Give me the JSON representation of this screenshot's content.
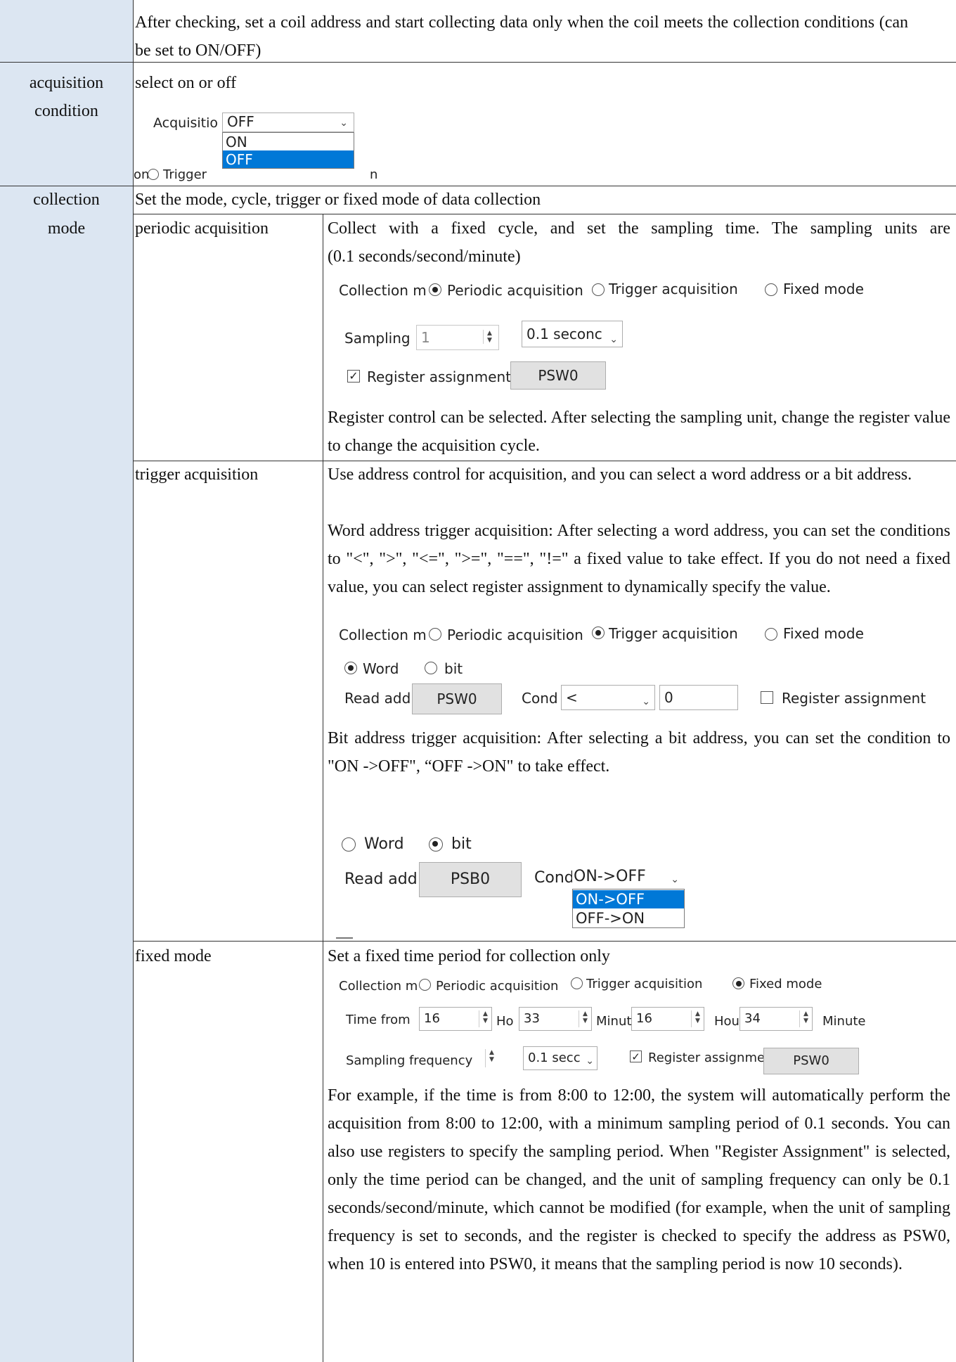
{
  "rows": {
    "coil": {
      "text": "After checking, set a coil address and start collecting data only when the coil meets the collection conditions (can be set to ON/OFF)"
    },
    "acquisition_condition": {
      "label_line1": "acquisition",
      "label_line2": "condition",
      "text": "select on or off",
      "ui": {
        "label": "Acquisitio",
        "selected": "OFF",
        "options": [
          "ON",
          "OFF"
        ],
        "under_left": "on",
        "under_radio_label": "Trigger",
        "under_right": "n"
      }
    },
    "collection_mode": {
      "label_line1": "collection",
      "label_line2": "mode",
      "text": "Set the mode, cycle, trigger or fixed mode of data collection"
    }
  },
  "periodic": {
    "name": "periodic acquisition",
    "desc_line1": "Collect with a fixed cycle, and set the sampling time. The sampling units are",
    "desc_line2": "(0.1 seconds/second/minute)",
    "ui": {
      "mode_label": "Collection m",
      "opt_periodic": "Periodic acquisition",
      "opt_trigger": "Trigger acquisition",
      "opt_fixed": "Fixed mode",
      "sampling_label": "Sampling",
      "sampling_value": "1",
      "unit_value": "0.1 seconc",
      "register_label": "Register assignment",
      "register_value": "PSW0"
    },
    "note": "Register control can be selected. After selecting the sampling unit, change the register value to change the acquisition cycle."
  },
  "trigger": {
    "name": "trigger acquisition",
    "desc1": "Use address control for acquisition, and you can select a word address or a bit address.",
    "desc2": "Word address trigger acquisition: After selecting a word address, you can set the conditions to \"<\", \">\", \"<=\", \">=\", \"==\", \"!=\" a fixed value to take effect. If you do not need a fixed value, you can select register assignment to dynamically specify the value.",
    "ui_word": {
      "mode_label": "Collection m",
      "opt_periodic": "Periodic acquisition",
      "opt_trigger": "Trigger acquisition",
      "opt_fixed": "Fixed mode",
      "opt_word": "Word",
      "opt_bit": "bit",
      "read_label": "Read add",
      "read_value": "PSW0",
      "cond_label": "Cond",
      "cond_value": "<",
      "fixed_value": "0",
      "register_label": "Register assignment"
    },
    "desc3": "Bit address trigger acquisition: After selecting a bit address, you can set the condition to \"ON ->OFF\", “OFF ->ON\" to take effect.",
    "ui_bit": {
      "opt_word": "Word",
      "opt_bit": "bit",
      "read_label": "Read add",
      "read_value": "PSB0",
      "cond_label": "Cond",
      "cond_value": "ON->OFF",
      "options": [
        "ON->OFF",
        "OFF->ON"
      ]
    }
  },
  "fixed": {
    "name": "fixed mode",
    "desc": "Set a fixed time period for collection only",
    "ui": {
      "mode_label": "Collection m",
      "opt_periodic": "Periodic acquisition",
      "opt_trigger": "Trigger acquisition",
      "opt_fixed": "Fixed mode",
      "time_label": "Time from",
      "h1": "16",
      "h1_unit": "Ho",
      "m1": "33",
      "m1_unit": "Minut",
      "h2": "16",
      "h2_unit": "Hou",
      "m2": "34",
      "m2_unit": "Minute",
      "freq_label": "Sampling frequency",
      "unit_value": "0.1 secc",
      "register_label": "Register assignme",
      "register_value": "PSW0"
    },
    "note": "For example, if the time is from 8:00 to 12:00, the system will automatically perform the acquisition from 8:00 to 12:00, with a minimum sampling period of 0.1 seconds. You can also use registers to specify the sampling period. When \"Register Assignment\" is selected, only the time period can be changed, and the unit of sampling frequency can only be 0.1 seconds/second/minute, which cannot be modified (for example, when the unit of sampling frequency is set to seconds, and the register is checked to specify the address as PSW0, when 10 is entered into PSW0, it means that the sampling period is now 10 seconds)."
  }
}
